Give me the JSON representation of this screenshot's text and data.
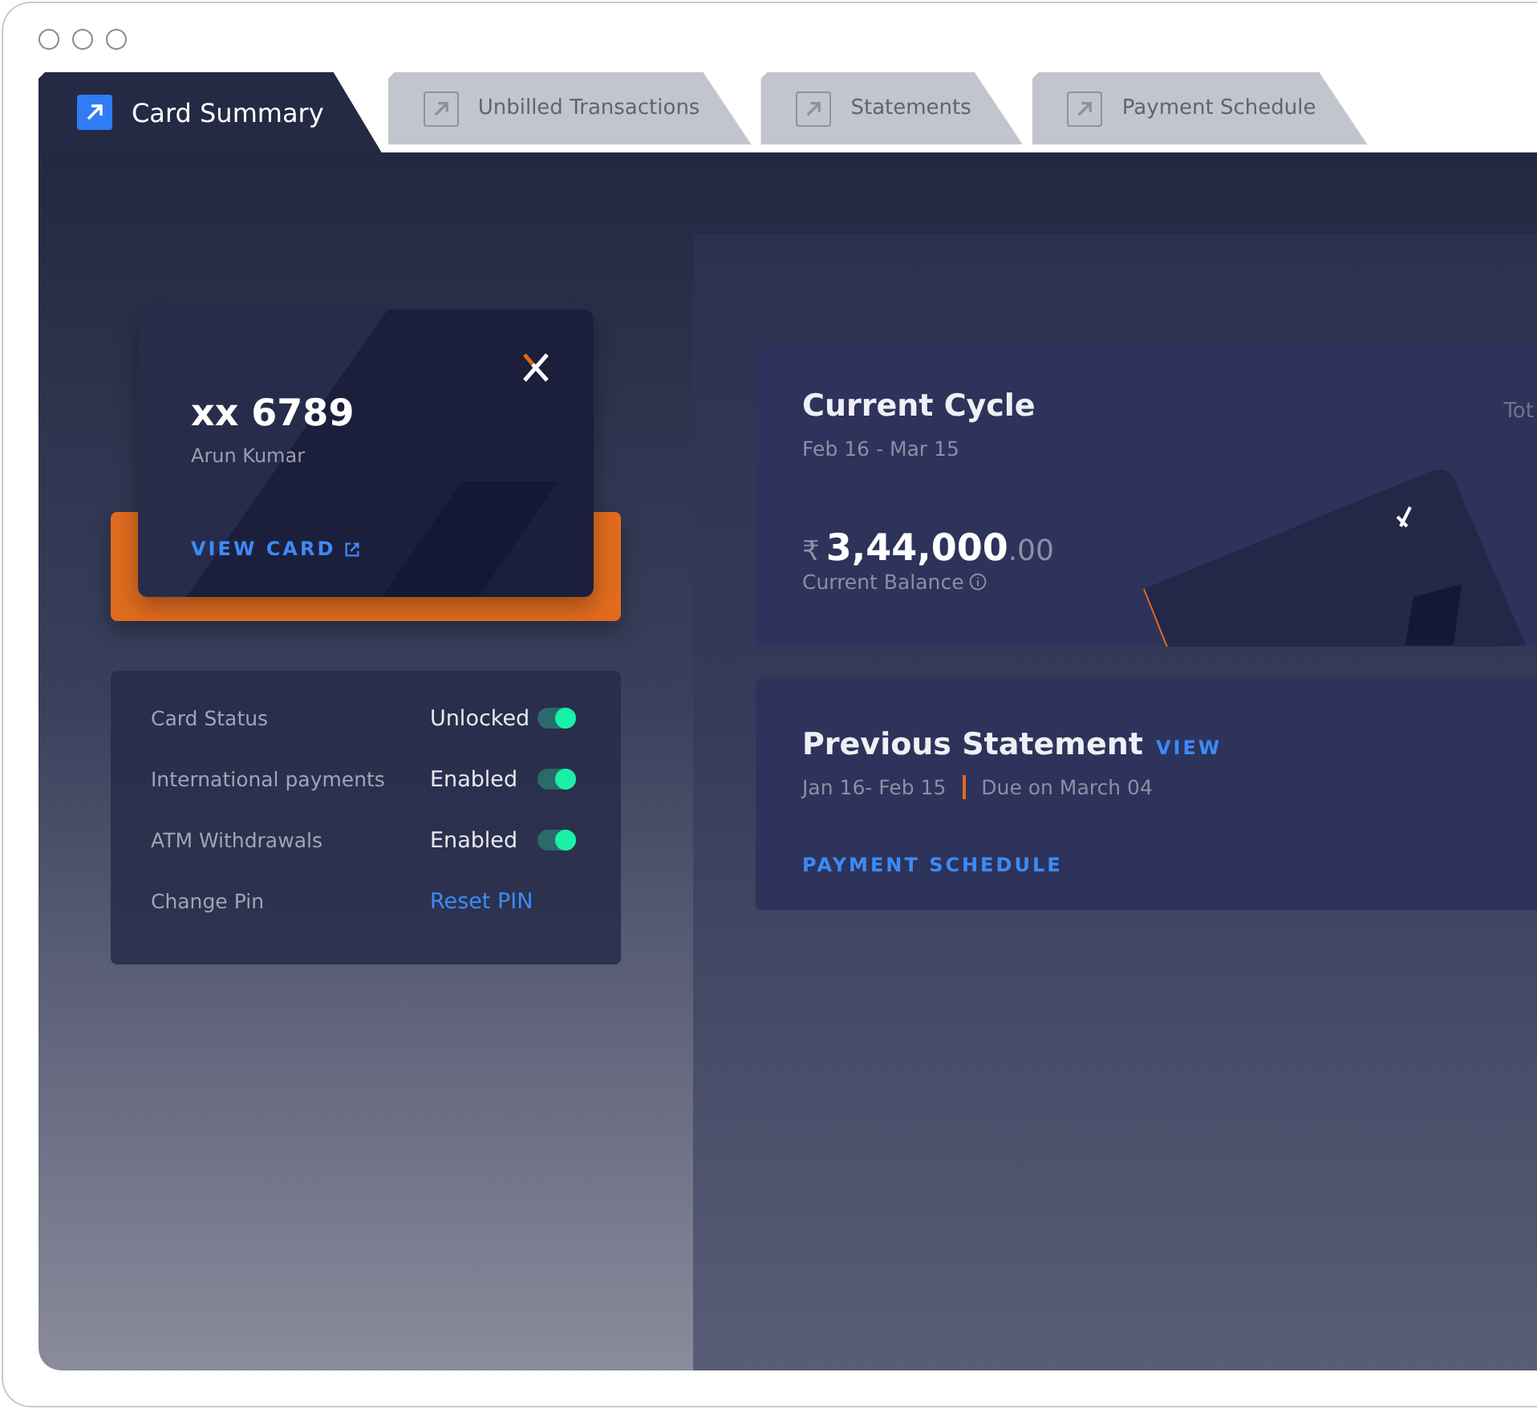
{
  "tabs": [
    {
      "label": "Card Summary",
      "selected": true
    },
    {
      "label": "Unbilled Transactions",
      "selected": false
    },
    {
      "label": "Statements",
      "selected": false
    },
    {
      "label": "Payment Schedule",
      "selected": false
    }
  ],
  "card": {
    "number": "xx 6789",
    "holder": "Arun Kumar",
    "link": "VIEW CARD"
  },
  "settings": [
    {
      "kind": "toggle",
      "label": "Card Status",
      "value": "Unlocked",
      "on": true
    },
    {
      "kind": "toggle",
      "label": "International payments",
      "value": "Enabled",
      "on": true
    },
    {
      "kind": "toggle",
      "label": "ATM Withdrawals",
      "value": "Enabled",
      "on": true
    },
    {
      "kind": "link",
      "label": "Change Pin",
      "value": "Reset PIN"
    }
  ],
  "current_cycle": {
    "title": "Current Cycle",
    "dates": "Feb 16 - Mar 15",
    "currency": "₹",
    "amount": "3,44,000",
    "decimals": ".00",
    "caption": "Current Balance",
    "column_2": "Tot"
  },
  "previous_statement": {
    "title": "Previous Statement",
    "view": "VIEW",
    "dates": "Jan 16- Feb 15",
    "due": "Due on March 04",
    "link": "PAYMENT SCHEDULE"
  }
}
